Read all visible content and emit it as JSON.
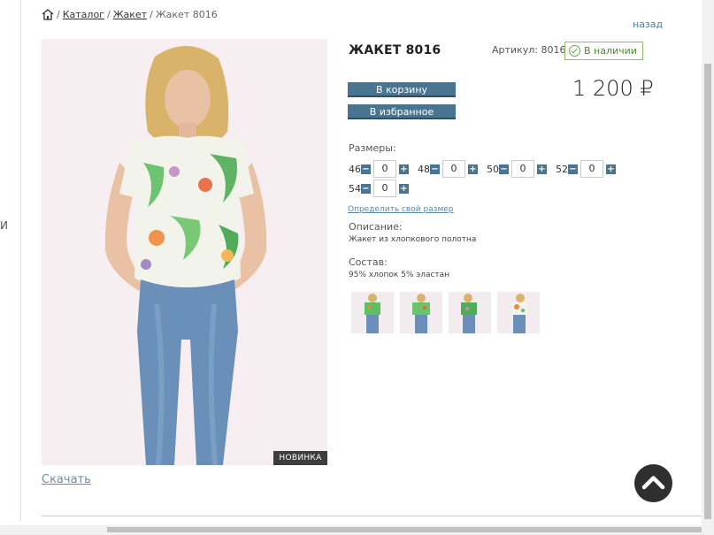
{
  "sidebar": {
    "edge_char": "И"
  },
  "breadcrumb": {
    "sep": "/",
    "items": [
      "Каталог",
      "Жакет"
    ],
    "current": "Жакет 8016"
  },
  "back_label": "назад",
  "product": {
    "title": "ЖАКЕТ 8016",
    "sku": "Артикул: 8016",
    "stock": "В наличии",
    "price": "1 200 ₽",
    "badge": "НОВИНКА",
    "download": "Скачать"
  },
  "buttons": {
    "cart": "В корзину",
    "favorites": "В избранное"
  },
  "sizes": {
    "label": "Размеры:",
    "minus": "−",
    "plus": "+",
    "items": [
      {
        "size": "46",
        "qty": "0"
      },
      {
        "size": "48",
        "qty": "0"
      },
      {
        "size": "50",
        "qty": "0"
      },
      {
        "size": "52",
        "qty": "0"
      },
      {
        "size": "54",
        "qty": "0"
      }
    ],
    "size_link": "Определить свой размер"
  },
  "description": {
    "label": "Описание:",
    "text": "Жакет из хлопкового полотна"
  },
  "composition": {
    "label": "Состав:",
    "text": "95% хлопок 5% эластан"
  },
  "colors": {
    "accent": "#4a7590",
    "stock_green": "#6aa84f",
    "blouse_green": "#5fbf63",
    "jeans_blue": "#6a8fb8",
    "hair": "#d9b36a",
    "skin": "#e9c2a6"
  },
  "icons": {
    "home": "home-icon",
    "check": "check-circle-icon",
    "up": "chevron-up-icon"
  }
}
